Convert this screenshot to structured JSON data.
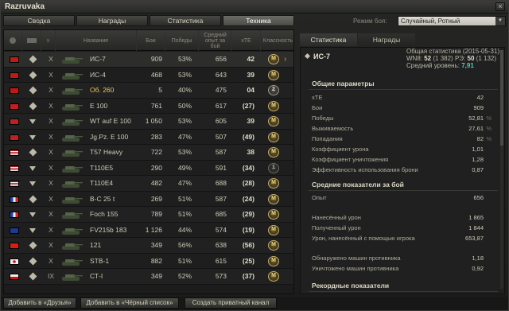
{
  "window": {
    "title": "Razruvaka",
    "close": "×"
  },
  "tabs": [
    "Сводка",
    "Награды",
    "Статистика",
    "Техника"
  ],
  "active_tab": 3,
  "mode": {
    "label": "Режим боя:",
    "value": "Случайный, Ротный"
  },
  "table": {
    "headers": {
      "nation": "",
      "type": "",
      "level": "",
      "name": "Название",
      "battles": "Бои",
      "wins": "Победы",
      "avg_exp": "Средний опыт за бой",
      "xte": "xTE",
      "mastery": "Классность"
    },
    "rows": [
      {
        "flag": "ussr",
        "type": "heavy",
        "level": "X",
        "name": "ИС-7",
        "gold": false,
        "battles": "909",
        "wins": "53%",
        "exp": "656",
        "xte": "42",
        "mastery": "М",
        "m": "m3",
        "sel": true
      },
      {
        "flag": "ussr",
        "type": "heavy",
        "level": "X",
        "name": "ИС-4",
        "gold": false,
        "battles": "468",
        "wins": "53%",
        "exp": "643",
        "xte": "39",
        "mastery": "М",
        "m": "m3",
        "sel": false
      },
      {
        "flag": "ussr",
        "type": "heavy",
        "level": "X",
        "name": "Об. 260",
        "gold": true,
        "battles": "5",
        "wins": "40%",
        "exp": "475",
        "xte": "04",
        "mastery": "2",
        "m": "m2",
        "sel": false
      },
      {
        "flag": "ger",
        "type": "heavy",
        "level": "X",
        "name": "E 100",
        "gold": false,
        "battles": "761",
        "wins": "50%",
        "exp": "617",
        "xte": "(27)",
        "mastery": "М",
        "m": "m3",
        "sel": false
      },
      {
        "flag": "ger",
        "type": "td",
        "level": "X",
        "name": "WT auf E 100",
        "gold": false,
        "battles": "1 050",
        "wins": "53%",
        "exp": "605",
        "xte": "39",
        "mastery": "М",
        "m": "m3",
        "sel": false
      },
      {
        "flag": "ger",
        "type": "td",
        "level": "X",
        "name": "Jg.Pz. E 100",
        "gold": false,
        "battles": "283",
        "wins": "47%",
        "exp": "507",
        "xte": "(49)",
        "mastery": "М",
        "m": "m3",
        "sel": false
      },
      {
        "flag": "usa",
        "type": "heavy",
        "level": "X",
        "name": "T57 Heavy",
        "gold": false,
        "battles": "722",
        "wins": "53%",
        "exp": "587",
        "xte": "38",
        "mastery": "М",
        "m": "m3",
        "sel": false
      },
      {
        "flag": "usa",
        "type": "td",
        "level": "X",
        "name": "T110E5",
        "gold": false,
        "battles": "290",
        "wins": "49%",
        "exp": "591",
        "xte": "(34)",
        "mastery": "1",
        "m": "m1",
        "sel": false
      },
      {
        "flag": "usa",
        "type": "td",
        "level": "X",
        "name": "T110E4",
        "gold": false,
        "battles": "482",
        "wins": "47%",
        "exp": "688",
        "xte": "(28)",
        "mastery": "М",
        "m": "m3",
        "sel": false
      },
      {
        "flag": "fra",
        "type": "heavy",
        "level": "X",
        "name": "B-C 25 t",
        "gold": false,
        "battles": "269",
        "wins": "51%",
        "exp": "587",
        "xte": "(24)",
        "mastery": "М",
        "m": "m3",
        "sel": false
      },
      {
        "flag": "fra",
        "type": "td",
        "level": "X",
        "name": "Foch 155",
        "gold": false,
        "battles": "789",
        "wins": "51%",
        "exp": "685",
        "xte": "(29)",
        "mastery": "М",
        "m": "m3",
        "sel": false
      },
      {
        "flag": "uk",
        "type": "td",
        "level": "X",
        "name": "FV215b 183",
        "gold": false,
        "battles": "1 126",
        "wins": "44%",
        "exp": "574",
        "xte": "(19)",
        "mastery": "М",
        "m": "m3",
        "sel": false
      },
      {
        "flag": "china",
        "type": "heavy",
        "level": "X",
        "name": "121",
        "gold": false,
        "battles": "349",
        "wins": "56%",
        "exp": "638",
        "xte": "(56)",
        "mastery": "М",
        "m": "m3",
        "sel": false
      },
      {
        "flag": "japan",
        "type": "heavy",
        "level": "X",
        "name": "STB-1",
        "gold": false,
        "battles": "882",
        "wins": "51%",
        "exp": "615",
        "xte": "(25)",
        "mastery": "М",
        "m": "m3",
        "sel": false
      },
      {
        "flag": "czech",
        "type": "heavy",
        "level": "IX",
        "name": "СТ-І",
        "gold": false,
        "battles": "349",
        "wins": "52%",
        "exp": "573",
        "xte": "(37)",
        "mastery": "М",
        "m": "m3",
        "sel": false
      }
    ]
  },
  "right": {
    "tabs": [
      "Статистика",
      "Награды"
    ],
    "vehicle": "ИС-7",
    "overall": {
      "line1": "Общая статистика (2015-05-31)",
      "wn8_label": "WN8:",
      "wn8": "52",
      "wn8_extra": "(1 382)",
      "r_label": "РЭ:",
      "r": "50",
      "r_extra": "(1 132)",
      "avg_level_label": "Средний уровень:",
      "avg_level": "7,91"
    },
    "general": {
      "title": "Общие параметры",
      "items": [
        {
          "k": "xTE",
          "v": "42",
          "u": ""
        },
        {
          "k": "Бои",
          "v": "909",
          "u": ""
        },
        {
          "k": "Победы",
          "v": "52,81",
          "u": "%"
        },
        {
          "k": "Выживаемость",
          "v": "27,61",
          "u": "%"
        },
        {
          "k": "Попадания",
          "v": "82",
          "u": "%"
        },
        {
          "k": "Коэффициент урона",
          "v": "1,01",
          "u": ""
        },
        {
          "k": "Коэффициент уничтожения",
          "v": "1,28",
          "u": ""
        },
        {
          "k": "Эффективность использования брони",
          "v": "0,87",
          "u": ""
        }
      ]
    },
    "avg": {
      "title": "Средние показатели за бой",
      "items": [
        {
          "k": "Опыт",
          "v": "656",
          "u": ""
        },
        {
          "k": "Нанесённый урон",
          "v": "1 865",
          "u": ""
        },
        {
          "k": "Полученный урон",
          "v": "1 844",
          "u": ""
        },
        {
          "k": "Урон, нанесённый с помощью игрока",
          "v": "653,87",
          "u": ""
        },
        {
          "k": "Обнаружено машин противника",
          "v": "1,18",
          "u": ""
        },
        {
          "k": "Уничтожено машин противника",
          "v": "0,92",
          "u": ""
        }
      ]
    },
    "records": {
      "title": "Рекордные показатели"
    }
  },
  "buttons": [
    "Добавить в «Друзья»",
    "Добавить в «Чёрный список»",
    "Создать приватный канал"
  ]
}
